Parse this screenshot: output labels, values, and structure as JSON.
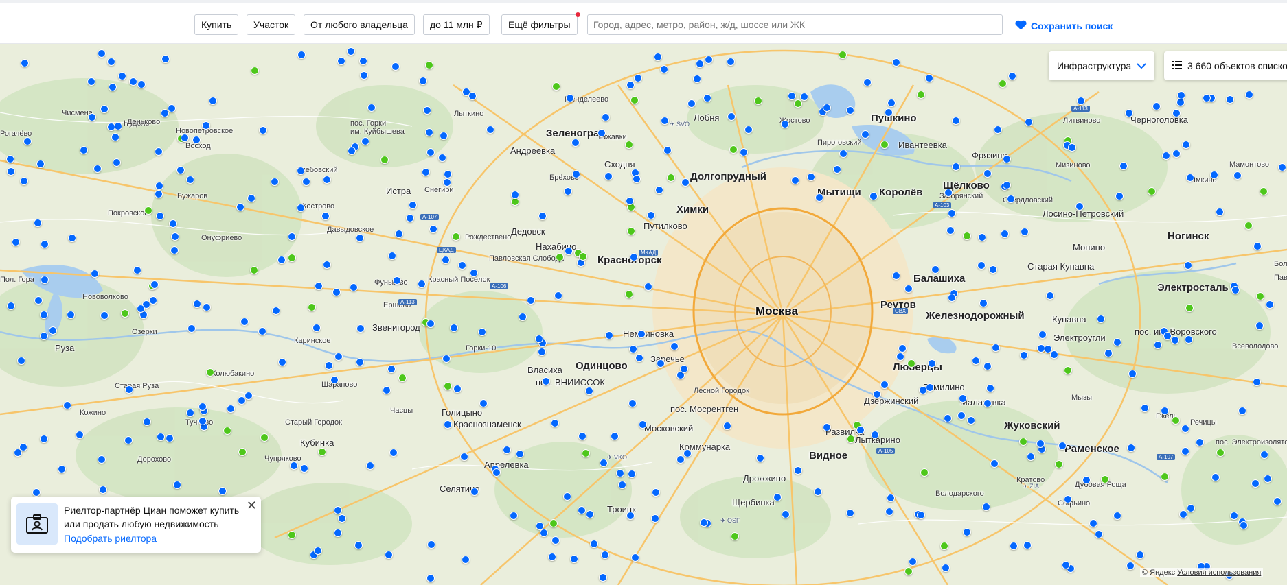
{
  "filters": {
    "buy": "Купить",
    "type": "Участок",
    "owner": "От любого владельца",
    "price": "до 11 млн ₽",
    "more": "Ещё фильтры"
  },
  "search": {
    "placeholder": "Город, адрес, метро, район, ж/д, шоссе или ЖК"
  },
  "save_search": "Сохранить поиск",
  "map": {
    "infrastructure": "Инфраструктура",
    "objects_list": "3 660 объектов списком",
    "copyright": "© Яндекс",
    "terms": "Условия использования",
    "colors": {
      "blue_marker": "#0468ff",
      "green_marker": "#4ec71b",
      "accent": "#0468ff"
    },
    "labels": [
      {
        "text": "Москва",
        "size": "huge"
      },
      {
        "text": "Зеленоград",
        "size": "big"
      },
      {
        "text": "Химки",
        "size": "big"
      },
      {
        "text": "Долгопрудный",
        "size": "big"
      },
      {
        "text": "Мытищи",
        "size": "big"
      },
      {
        "text": "Королёв",
        "size": "big"
      },
      {
        "text": "Пушкино",
        "size": "big"
      },
      {
        "text": "Щёлково",
        "size": "big"
      },
      {
        "text": "Ногинск",
        "size": "big"
      },
      {
        "text": "Балашиха",
        "size": "big"
      },
      {
        "text": "Реутов",
        "size": "big"
      },
      {
        "text": "Железнодорожный",
        "size": "big"
      },
      {
        "text": "Электросталь",
        "size": "big"
      },
      {
        "text": "Люберцы",
        "size": "big"
      },
      {
        "text": "Одинцово",
        "size": "big"
      },
      {
        "text": "Красногорск",
        "size": "big"
      },
      {
        "text": "Видное",
        "size": "big"
      },
      {
        "text": "Жуковский",
        "size": "big"
      },
      {
        "text": "Раменское",
        "size": "big"
      },
      {
        "text": "Истра",
        "size": "mid"
      },
      {
        "text": "Дедовск",
        "size": "mid"
      },
      {
        "text": "Звенигород",
        "size": "mid"
      },
      {
        "text": "Руза",
        "size": "mid"
      },
      {
        "text": "Кубинка",
        "size": "mid"
      },
      {
        "text": "Голицыно",
        "size": "mid"
      },
      {
        "text": "Краснознаменск",
        "size": "mid"
      },
      {
        "text": "Апрелевка",
        "size": "mid"
      },
      {
        "text": "Селятино",
        "size": "mid"
      },
      {
        "text": "Троицк",
        "size": "mid"
      },
      {
        "text": "Щербинка",
        "size": "mid"
      },
      {
        "text": "Лыткарино",
        "size": "mid"
      },
      {
        "text": "Дзержинский",
        "size": "mid"
      },
      {
        "text": "Фрязино",
        "size": "mid"
      },
      {
        "text": "Ивантеевка",
        "size": "mid"
      },
      {
        "text": "Лобня",
        "size": "mid"
      },
      {
        "text": "Нахабино",
        "size": "mid"
      },
      {
        "text": "Власиха",
        "size": "mid"
      },
      {
        "text": "Заречье",
        "size": "mid"
      },
      {
        "text": "Немчиновка",
        "size": "mid"
      },
      {
        "text": "Московский",
        "size": "mid"
      },
      {
        "text": "Коммунарка",
        "size": "mid"
      },
      {
        "text": "Дрожжино",
        "size": "mid"
      },
      {
        "text": "Развилка",
        "size": "mid"
      },
      {
        "text": "Томилино",
        "size": "mid"
      },
      {
        "text": "Малаховка",
        "size": "mid"
      },
      {
        "text": "Купавна",
        "size": "mid"
      },
      {
        "text": "Старая Купавна",
        "size": "mid"
      },
      {
        "text": "Монино",
        "size": "mid"
      },
      {
        "text": "Лосино-Петровский",
        "size": "mid"
      },
      {
        "text": "Черноголовка",
        "size": "mid"
      },
      {
        "text": "Электроугли",
        "size": "mid"
      },
      {
        "text": "пос. им. Воровского",
        "size": "mid"
      },
      {
        "text": "Андреевка",
        "size": "mid"
      },
      {
        "text": "Сходня",
        "size": "mid"
      },
      {
        "text": "Путилково",
        "size": "mid"
      },
      {
        "text": "пос. ВНИИССОК",
        "size": "mid"
      },
      {
        "text": "пос. Мосрентген",
        "size": "mid"
      },
      {
        "text": "Горки-10",
        "size": "small"
      },
      {
        "text": "Менделеево",
        "size": "small"
      },
      {
        "text": "Жостово",
        "size": "small"
      },
      {
        "text": "Пироговский",
        "size": "small"
      },
      {
        "text": "Литвиново",
        "size": "small"
      },
      {
        "text": "Мамонтово",
        "size": "small"
      },
      {
        "text": "Ямкино",
        "size": "small"
      },
      {
        "text": "Всеволодово",
        "size": "small"
      },
      {
        "text": "Кратово",
        "size": "small"
      },
      {
        "text": "Рогачёво",
        "size": "small"
      },
      {
        "text": "Глебовский",
        "size": "small"
      },
      {
        "text": "Кострово",
        "size": "small"
      },
      {
        "text": "Давыдовское",
        "size": "small"
      },
      {
        "text": "Рождествено",
        "size": "small"
      },
      {
        "text": "Павловская Слобода",
        "size": "small"
      },
      {
        "text": "Красный Посёлок",
        "size": "small"
      },
      {
        "text": "Фуньково",
        "size": "small"
      },
      {
        "text": "Ершово",
        "size": "small"
      },
      {
        "text": "Каринское",
        "size": "small"
      },
      {
        "text": "Шарапово",
        "size": "small"
      },
      {
        "text": "Часцы",
        "size": "small"
      },
      {
        "text": "Старый Городок",
        "size": "small"
      },
      {
        "text": "Старая Руза",
        "size": "small"
      },
      {
        "text": "Кожино",
        "size": "small"
      },
      {
        "text": "Тучково",
        "size": "small"
      },
      {
        "text": "Колюбакино",
        "size": "small"
      },
      {
        "text": "Онуфриево",
        "size": "small"
      },
      {
        "text": "Покровское",
        "size": "small"
      },
      {
        "text": "Нововолково",
        "size": "small"
      },
      {
        "text": "Нудоль",
        "size": "small"
      },
      {
        "text": "Чисмена",
        "size": "small"
      },
      {
        "text": "Деньково",
        "size": "small"
      },
      {
        "text": "Новопетровское",
        "size": "small"
      },
      {
        "text": "Восход",
        "size": "small"
      },
      {
        "text": "Снегири",
        "size": "small"
      },
      {
        "text": "Бужаров",
        "size": "small"
      },
      {
        "text": "Чупряково",
        "size": "small"
      },
      {
        "text": "Лыткино",
        "size": "small"
      },
      {
        "text": "Брёхово",
        "size": "small"
      },
      {
        "text": "Загорянский",
        "size": "small"
      },
      {
        "text": "Свердловский",
        "size": "small"
      },
      {
        "text": "Мизиново",
        "size": "small"
      },
      {
        "text": "Ржавки",
        "size": "small"
      },
      {
        "text": "Софьино",
        "size": "small"
      },
      {
        "text": "Дубовая Роща",
        "size": "small"
      },
      {
        "text": "Речицы",
        "size": "small"
      },
      {
        "text": "пос. Электроизолятор",
        "size": "small"
      },
      {
        "text": "Гжель",
        "size": "small"
      },
      {
        "text": "Володарского",
        "size": "small"
      },
      {
        "text": "пос. Горки",
        "size": "small"
      },
      {
        "text": "им. Куйбышева",
        "size": "small"
      },
      {
        "text": "Озерки",
        "size": "small"
      },
      {
        "text": "Лесной Городок",
        "size": "small"
      },
      {
        "text": "Пол. Гора",
        "size": "small"
      },
      {
        "text": "Дорохово",
        "size": "small"
      },
      {
        "text": "Мызы",
        "size": "small"
      },
      {
        "text": "Павловский Посад",
        "size": "small"
      },
      {
        "text": "Большое",
        "size": "small"
      }
    ],
    "roads": [
      "А-107",
      "А-106",
      "А-113",
      "А-103",
      "А-113",
      "А-107",
      "А-105",
      "ЦКАД",
      "МКАД",
      "СВХ"
    ],
    "airports": [
      "SVO",
      "VKO",
      "ZIA",
      "OSF"
    ]
  },
  "realtor": {
    "text": "Риелтор-партнёр Циан поможет купить или продать любую недвижимость",
    "link": "Подобрать риелтора"
  }
}
